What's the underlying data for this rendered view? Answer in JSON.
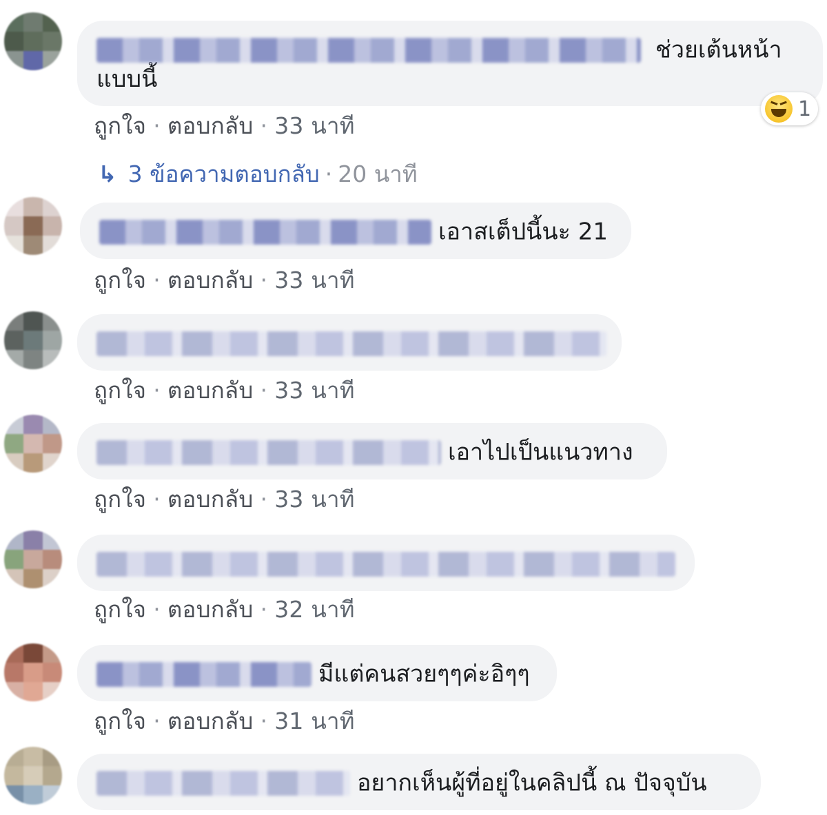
{
  "comments": [
    {
      "text_line1": "ช่วยเต้นหน้า",
      "text_line2": "แบบนี้",
      "actions": {
        "like": "ถูกใจ",
        "reply": "ตอบกลับ",
        "time": "33 นาที"
      },
      "reaction": {
        "icon": "haha-emoji-icon",
        "count": "1"
      },
      "replies": {
        "label": "3 ข้อความตอบกลับ",
        "time": "20 นาที"
      }
    },
    {
      "text": "เอาสเต็ปนี้นะ 21",
      "actions": {
        "like": "ถูกใจ",
        "reply": "ตอบกลับ",
        "time": "33 นาที"
      }
    },
    {
      "text": "",
      "actions": {
        "like": "ถูกใจ",
        "reply": "ตอบกลับ",
        "time": "33 นาที"
      }
    },
    {
      "text": "เอาไปเป็นแนวทาง",
      "actions": {
        "like": "ถูกใจ",
        "reply": "ตอบกลับ",
        "time": "33 นาที"
      }
    },
    {
      "text": "",
      "actions": {
        "like": "ถูกใจ",
        "reply": "ตอบกลับ",
        "time": "32 นาที"
      }
    },
    {
      "text": "มีแต่คนสวยๆๆค่ะอิๆๆ",
      "actions": {
        "like": "ถูกใจ",
        "reply": "ตอบกลับ",
        "time": "31 นาที"
      }
    },
    {
      "text": "อยากเห็นผู้ที่อยู่ในคลิปนี้ ณ ปัจจุบัน"
    }
  ],
  "separator": "·",
  "colors": {
    "bubble": "#f2f3f5",
    "link": "#4267b2",
    "meta": "#606770",
    "text": "#1c1e21"
  }
}
